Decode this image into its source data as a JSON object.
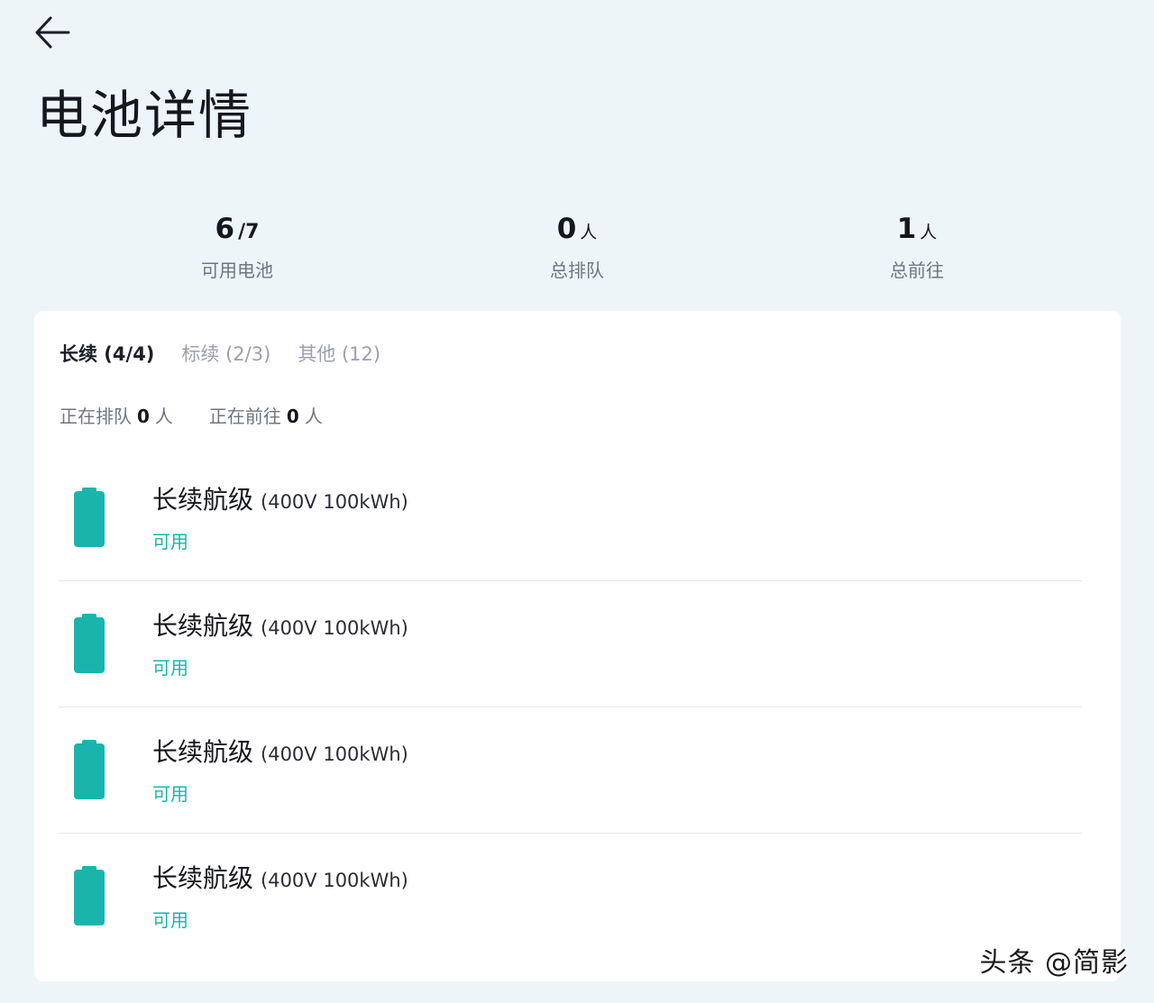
{
  "header": {
    "back_icon": "arrow-left-icon",
    "title": "电池详情"
  },
  "stats": [
    {
      "value": "6",
      "suffix": "/7",
      "label": "可用电池"
    },
    {
      "value": "0",
      "suffix": "人",
      "label": "总排队"
    },
    {
      "value": "1",
      "suffix": "人",
      "label": "总前往"
    }
  ],
  "tabs": [
    {
      "label": "长续 (4/4)",
      "active": true
    },
    {
      "label": "标续 (2/3)",
      "active": false
    },
    {
      "label": "其他 (12)",
      "active": false
    }
  ],
  "queue": {
    "queuing_label": "正在排队",
    "queuing_count": "0",
    "queuing_unit": "人",
    "heading_label": "正在前往",
    "heading_count": "0",
    "heading_unit": "人"
  },
  "batteries": [
    {
      "name": "长续航级",
      "spec": "(400V 100kWh)",
      "status": "可用",
      "icon": "battery-full-icon"
    },
    {
      "name": "长续航级",
      "spec": "(400V 100kWh)",
      "status": "可用",
      "icon": "battery-full-icon"
    },
    {
      "name": "长续航级",
      "spec": "(400V 100kWh)",
      "status": "可用",
      "icon": "battery-full-icon"
    },
    {
      "name": "长续航级",
      "spec": "(400V 100kWh)",
      "status": "可用",
      "icon": "battery-full-icon"
    }
  ],
  "colors": {
    "background": "#eef5f8",
    "accent": "#19b5ad",
    "card": "#ffffff"
  },
  "watermark": "头条 @简影"
}
